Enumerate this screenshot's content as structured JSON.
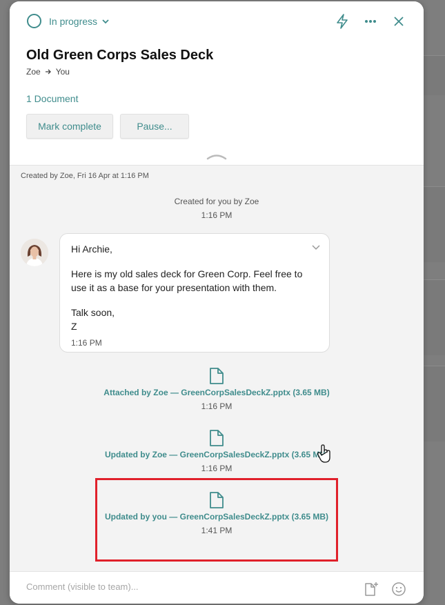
{
  "header": {
    "status_label": "In progress",
    "title": "Old Green Corps Sales Deck",
    "from": "Zoe",
    "to": "You",
    "documents_link": "1 Document",
    "mark_complete_label": "Mark complete",
    "pause_label": "Pause..."
  },
  "activity": {
    "created_by": "Created by Zoe, Fri 16 Apr at 1:16 PM",
    "created_event": {
      "text": "Created for you by Zoe",
      "time": "1:16 PM"
    },
    "message": {
      "greeting": "Hi Archie,",
      "body": "Here is my old sales deck for Green Corp. Feel free to use it as a base for your presentation with them.",
      "closing_line1": "Talk soon,",
      "closing_line2": "Z",
      "time": "1:16 PM"
    },
    "file_events": [
      {
        "text": "Attached by Zoe — GreenCorpSalesDeckZ.pptx (3.65 MB)",
        "time": "1:16 PM"
      },
      {
        "text": "Updated by Zoe — GreenCorpSalesDeckZ.pptx (3.65 MB)",
        "time": "1:16 PM"
      },
      {
        "text": "Updated by you — GreenCorpSalesDeckZ.pptx (3.65 MB)",
        "time": "1:41 PM"
      }
    ]
  },
  "comment": {
    "placeholder": "Comment (visible to team)..."
  },
  "colors": {
    "accent": "#3f8c8c",
    "highlight": "#e0202a"
  }
}
